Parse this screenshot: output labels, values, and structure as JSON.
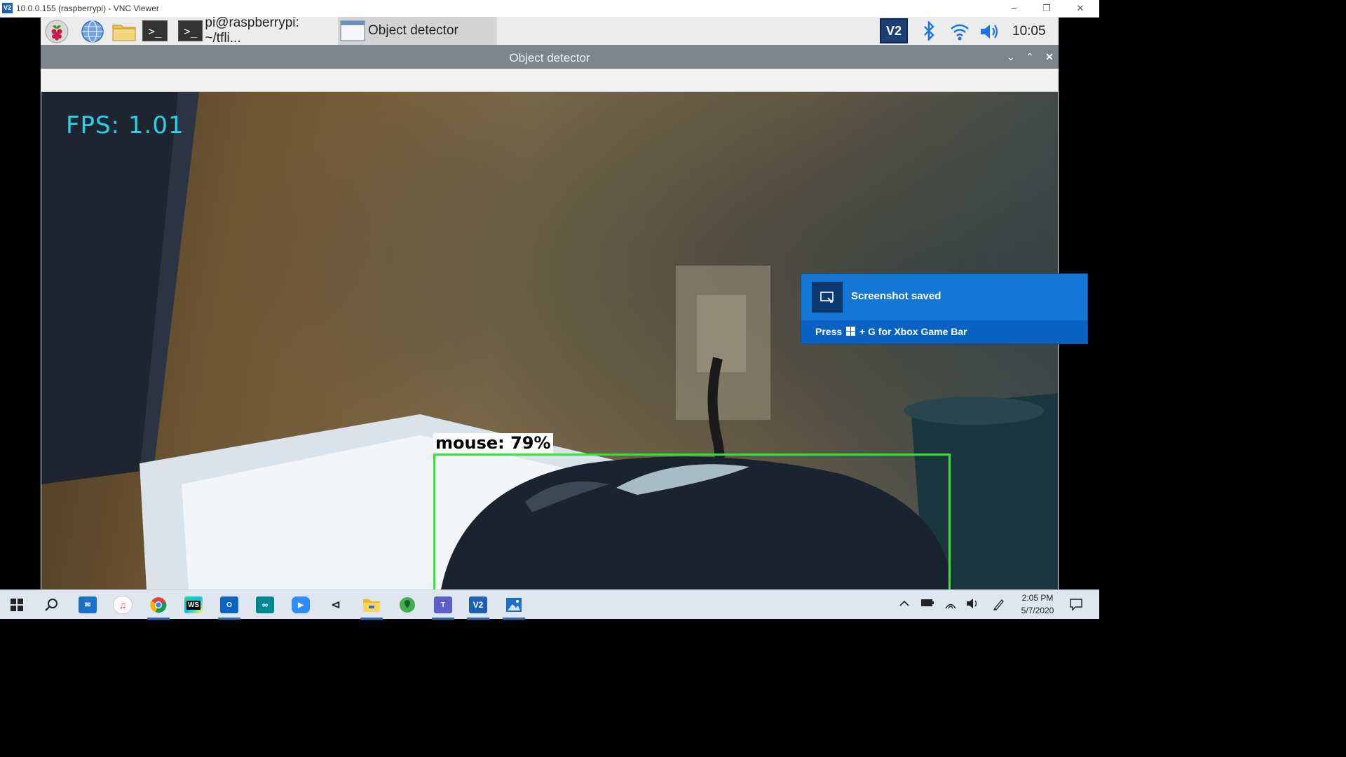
{
  "vnc_window": {
    "logo_text": "V2",
    "title": "10.0.0.155 (raspberrypi) - VNC Viewer",
    "controls": {
      "minimize": "–",
      "restore": "❐",
      "close": "✕"
    }
  },
  "pi_panel": {
    "launchers": [
      "raspberry-menu",
      "web-browser",
      "file-manager",
      "terminal"
    ],
    "tasks": [
      {
        "label": "pi@raspberrypi: ~/tfli...",
        "icon": "terminal-icon"
      },
      {
        "label": "Object detector",
        "icon": "window-icon"
      }
    ],
    "tray": {
      "vnc_text": "V2",
      "clock": "10:05"
    }
  },
  "detector_window": {
    "title": "Object detector",
    "controls": {
      "minimize": "⌄",
      "maximize": "⌃",
      "close": "✕"
    }
  },
  "camera": {
    "fps_text": "FPS:  1.01",
    "detections": [
      {
        "label": "mouse:  79%",
        "color": "#2ee833"
      }
    ]
  },
  "toast": {
    "title": "Screenshot saved",
    "body_prefix": "Press",
    "body_suffix": "+ G for Xbox Game Bar"
  },
  "win_taskbar": {
    "apps": [
      "start",
      "search",
      "mail",
      "itunes",
      "chrome",
      "webstorm",
      "outlook",
      "arduino",
      "zoom",
      "visual-studio",
      "file-explorer",
      "maps",
      "teams",
      "vnc-viewer",
      "photos"
    ],
    "time": "2:05 PM",
    "date": "5/7/2020"
  },
  "colors": {
    "fps": "#25d4e8",
    "detection_box": "#2ee833",
    "toast_bg": "#1477d6",
    "od_titlebar": "#7a858c"
  }
}
